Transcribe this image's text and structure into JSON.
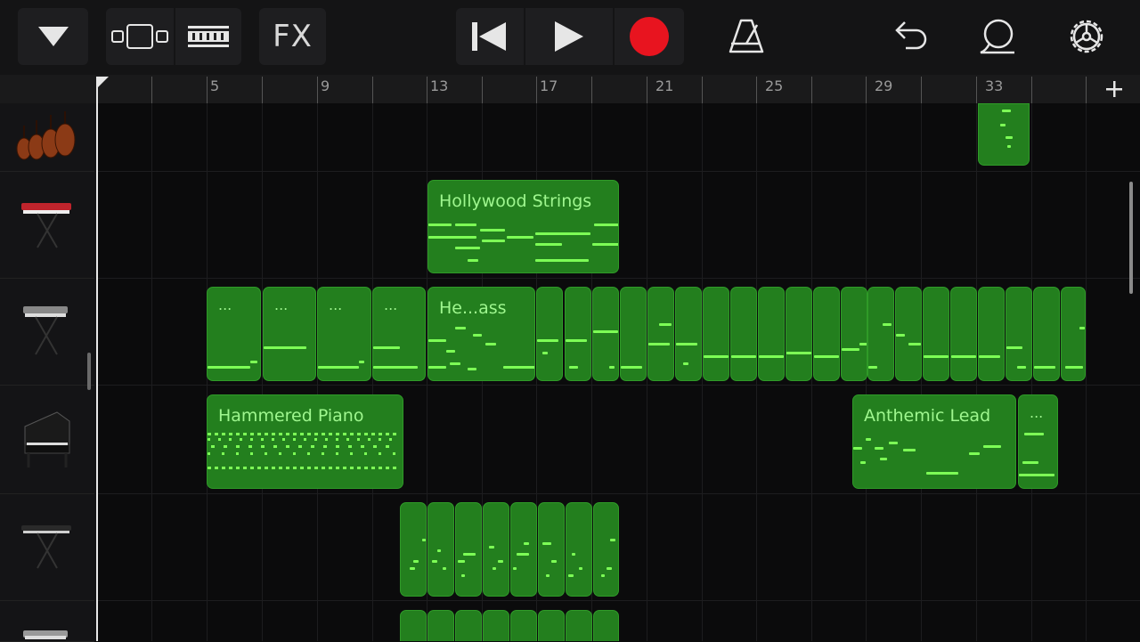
{
  "toolbar": {
    "fx_label": "FX"
  },
  "ruler": {
    "bar_numbers": [
      "5",
      "9",
      "13",
      "17",
      "21",
      "25",
      "29",
      "33"
    ]
  },
  "tracks": [
    {
      "instrument": "strings-ensemble-icon"
    },
    {
      "instrument": "red-synth-keyboard-icon"
    },
    {
      "instrument": "synth-bass-keyboard-icon"
    },
    {
      "instrument": "grand-piano-icon"
    },
    {
      "instrument": "black-keyboard-icon"
    },
    {
      "instrument": "keyboard-icon"
    }
  ],
  "regions": {
    "hollywood_strings": "Hollywood Strings",
    "heavy_bass": "He...ass",
    "hammered_piano": "Hammered Piano",
    "anthemic_lead": "Anthemic Lead",
    "ellipsis": "..."
  },
  "colors": {
    "region_fill": "#237f1e",
    "note": "#7dff56",
    "record": "#e8141f"
  }
}
